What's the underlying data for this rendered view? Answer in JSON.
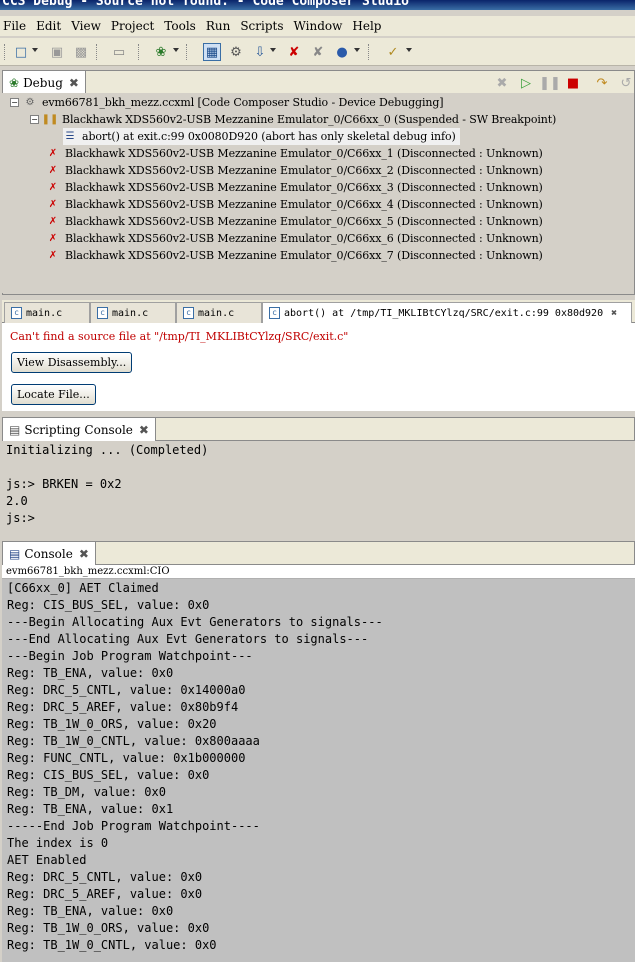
{
  "window": {
    "title": "CCS Debug - Source not found. - Code Composer Studio"
  },
  "menu": [
    "File",
    "Edit",
    "View",
    "Project",
    "Tools",
    "Run",
    "Scripts",
    "Window",
    "Help"
  ],
  "debug_view": {
    "tab_label": "Debug",
    "tree": {
      "root": "evm66781_bkh_mezz.ccxml [Code Composer Studio - Device Debugging]",
      "core0": "Blackhawk XDS560v2-USB Mezzanine Emulator_0/C66xx_0 (Suspended - SW Breakpoint)",
      "frame": "abort() at exit.c:99 0x0080D920  (abort has only skeletal debug info)",
      "cores": [
        "Blackhawk XDS560v2-USB Mezzanine Emulator_0/C66xx_1 (Disconnected : Unknown)",
        "Blackhawk XDS560v2-USB Mezzanine Emulator_0/C66xx_2 (Disconnected : Unknown)",
        "Blackhawk XDS560v2-USB Mezzanine Emulator_0/C66xx_3 (Disconnected : Unknown)",
        "Blackhawk XDS560v2-USB Mezzanine Emulator_0/C66xx_4 (Disconnected : Unknown)",
        "Blackhawk XDS560v2-USB Mezzanine Emulator_0/C66xx_5 (Disconnected : Unknown)",
        "Blackhawk XDS560v2-USB Mezzanine Emulator_0/C66xx_6 (Disconnected : Unknown)",
        "Blackhawk XDS560v2-USB Mezzanine Emulator_0/C66xx_7 (Disconnected : Unknown)"
      ]
    }
  },
  "editor": {
    "tabs": [
      "main.c",
      "main.c",
      "main.c",
      "abort() at /tmp/TI_MKLIBtCYlzq/SRC/exit.c:99 0x80d920"
    ],
    "error_text": "Can't find a source file at \"/tmp/TI_MKLIBtCYlzq/SRC/exit.c\"",
    "view_disassembly_label": "View Disassembly...",
    "locate_file_label": "Locate File..."
  },
  "scripting_console": {
    "tab_label": "Scripting Console",
    "lines": [
      "Initializing ... (Completed)",
      "",
      "js:> BRKEN = 0x2",
      "2.0",
      "js:>"
    ]
  },
  "console": {
    "tab_label": "Console",
    "source": "evm66781_bkh_mezz.ccxml:CIO",
    "lines": [
      "[C66xx_0] AET Claimed",
      "Reg: CIS_BUS_SEL, value: 0x0",
      "---Begin Allocating Aux Evt Generators to signals---",
      "---End Allocating Aux Evt Generators to signals---",
      "---Begin Job Program Watchpoint---",
      "Reg: TB_ENA, value: 0x0",
      "Reg: DRC_5_CNTL, value: 0x14000a0",
      "Reg: DRC_5_AREF, value: 0x80b9f4",
      "Reg: TB_1W_0_ORS, value: 0x20",
      "Reg: TB_1W_0_CNTL, value: 0x800aaaa",
      "Reg: FUNC_CNTL, value: 0x1b000000",
      "Reg: CIS_BUS_SEL, value: 0x0",
      "Reg: TB_DM, value: 0x0",
      "Reg: TB_ENA, value: 0x1",
      "-----End Job Program Watchpoint----",
      "The index is 0",
      "AET Enabled",
      "Reg: DRC_5_CNTL, value: 0x0",
      "Reg: DRC_5_AREF, value: 0x0",
      "Reg: TB_ENA, value: 0x0",
      "Reg: TB_1W_0_ORS, value: 0x0",
      "Reg: TB_1W_0_CNTL, value: 0x0"
    ]
  },
  "colors": {
    "error": "#c00000",
    "titlebar": "#0a246a"
  }
}
